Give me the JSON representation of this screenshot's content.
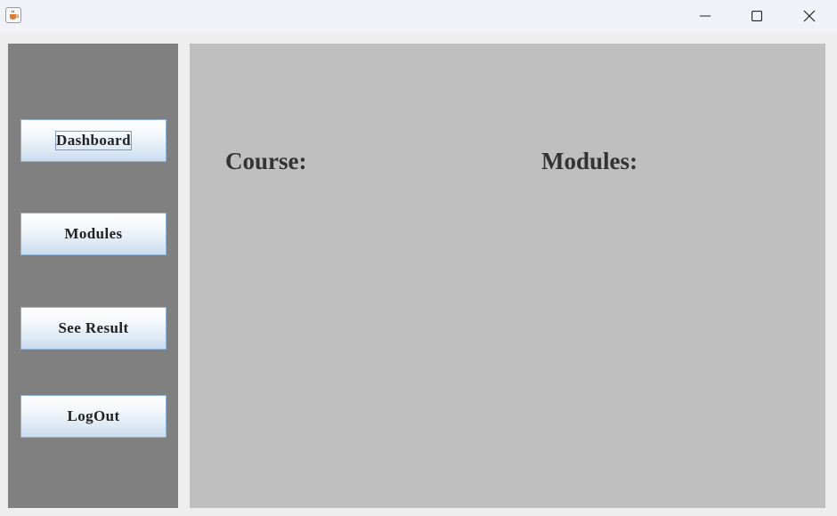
{
  "titlebar": {
    "icons": {
      "app": "java-coffee-icon",
      "minimize": "minimize-icon",
      "maximize": "maximize-icon",
      "close": "close-icon"
    }
  },
  "sidebar": {
    "items": [
      {
        "label": "Dashboard"
      },
      {
        "label": "Modules"
      },
      {
        "label": "See Result"
      },
      {
        "label": "LogOut"
      }
    ]
  },
  "main": {
    "course_label": "Course:",
    "modules_label": "Modules:"
  },
  "colors": {
    "sidebar_bg": "#808080",
    "main_bg": "#bfbfbf",
    "window_bg": "#eeeeee",
    "button_border": "#8fb3d6",
    "text": "#333333"
  }
}
